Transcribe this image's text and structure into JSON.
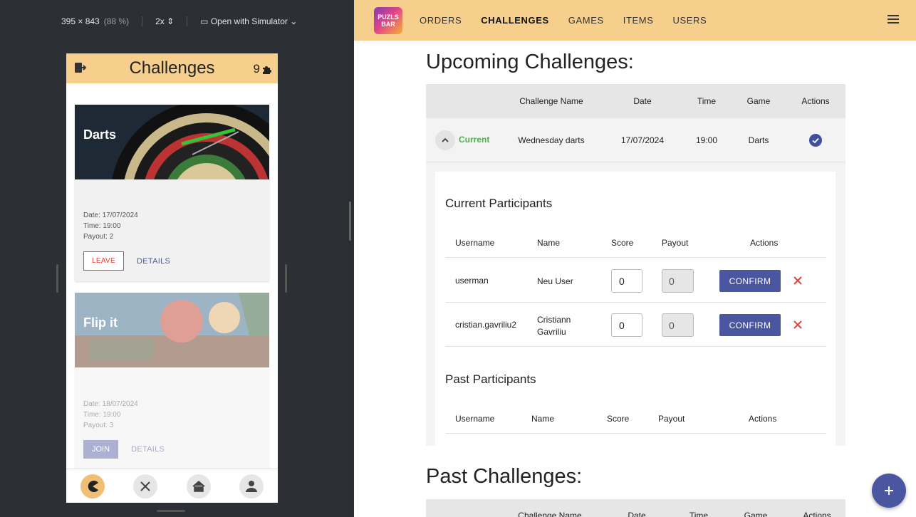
{
  "simulator": {
    "dimensions": "395 × 843",
    "zoom": "(88 %)",
    "scale": "2x",
    "open_with": "Open with Simulator"
  },
  "phone": {
    "header_title": "Challenges",
    "points": "9",
    "cards": [
      {
        "name": "Darts",
        "date": "Date: 17/07/2024",
        "time": "Time: 19:00",
        "payout": "Payout: 2",
        "primary_action": "LEAVE",
        "secondary_action": "DETAILS"
      },
      {
        "name": "Flip it",
        "date": "Date: 18/07/2024",
        "time": "Time: 19:00",
        "payout": "Payout: 3",
        "primary_action": "JOIN",
        "secondary_action": "DETAILS"
      }
    ],
    "nav_icons": [
      "pacman-icon",
      "tools-icon",
      "home-icon",
      "user-icon"
    ]
  },
  "admin": {
    "logo_text": [
      "PUZLS",
      "BAR"
    ],
    "nav": [
      "ORDERS",
      "CHALLENGES",
      "GAMES",
      "ITEMS",
      "USERS"
    ],
    "active_nav": "CHALLENGES",
    "upcoming_title": "Upcoming Challenges:",
    "columns": [
      "Challenge Name",
      "Date",
      "Time",
      "Game",
      "Actions"
    ],
    "upcoming_row": {
      "status": "Current",
      "name": "Wednesday darts",
      "date": "17/07/2024",
      "time": "19:00",
      "game": "Darts"
    },
    "current_participants_title": "Current Participants",
    "participant_columns": [
      "Username",
      "Name",
      "Score",
      "Payout",
      "Actions"
    ],
    "participants": [
      {
        "username": "userman",
        "name": "Neu User",
        "score": "0",
        "payout": "0",
        "action": "CONFIRM"
      },
      {
        "username": "cristian.gavriliu2",
        "name": "Cristiann Gavriliu",
        "score": "0",
        "payout": "0",
        "action": "CONFIRM"
      }
    ],
    "past_participants_title": "Past Participants",
    "past_title": "Past Challenges:",
    "colors": {
      "accent": "#f7cf8d",
      "primary": "#4a56a0",
      "success": "#4caf50",
      "danger": "#e0453a"
    }
  }
}
